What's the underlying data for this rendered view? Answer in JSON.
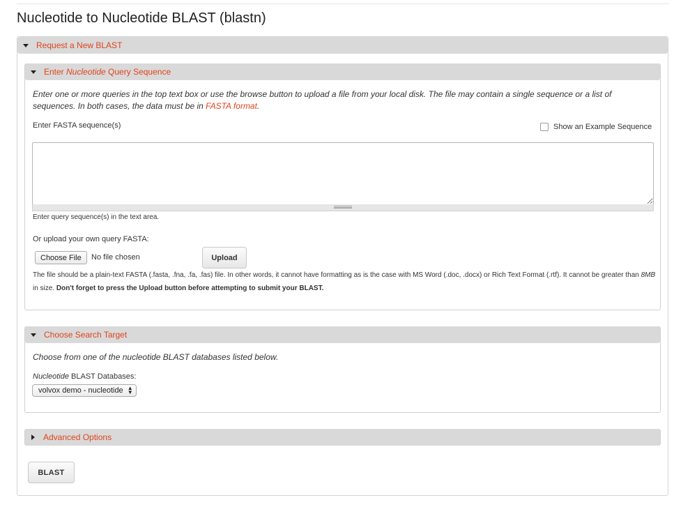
{
  "page": {
    "title": "Nucleotide to Nucleotide BLAST (blastn)"
  },
  "request_panel": {
    "label": "Request a New BLAST"
  },
  "query_panel": {
    "label_prefix": "Enter ",
    "label_italic": "Nucleotide",
    "label_suffix": " Query Sequence",
    "instructions_part1": "Enter one or more queries in the top text box or use the browse button to upload a file from your local disk. The file may contain a single sequence or a list of sequences. In both cases, the data must be in ",
    "instructions_link": "FASTA format",
    "instructions_part2": ".",
    "fasta_label": "Enter FASTA sequence(s)",
    "example_checkbox_label": "Show an Example Sequence",
    "example_checked": false,
    "textarea_value": "",
    "textarea_hint": "Enter query sequence(s) in the text area.",
    "upload_label": "Or upload your own query FASTA:",
    "choose_file_label": "Choose File",
    "no_file_text": "No file chosen",
    "upload_button": "Upload",
    "file_note_part1": "The file should be a plain-text FASTA (.fasta, .fna, .fa, .fas) file. In other words, it cannot have formatting as is the case with MS Word (.doc, .docx) or Rich Text Format (.rtf). It cannot be greater than ",
    "file_note_size": "8MB",
    "file_note_part2": " in size. ",
    "file_note_bold": "Don't forget to press the Upload button before attempting to submit your BLAST."
  },
  "target_panel": {
    "label": "Choose Search Target",
    "description": "Choose from one of the nucleotide BLAST databases listed below.",
    "db_label_italic": "Nucleotide",
    "db_label_rest": " BLAST Databases:",
    "db_selected": "volvox demo - nucleotide"
  },
  "advanced_panel": {
    "label": "Advanced Options"
  },
  "submit": {
    "label": "BLAST"
  },
  "colors": {
    "link": "#e0431a",
    "header_bg": "#d9d9d9"
  },
  "icons": {
    "expanded": "triangle-down-icon",
    "collapsed": "triangle-right-icon",
    "select": "select-arrows-icon"
  }
}
